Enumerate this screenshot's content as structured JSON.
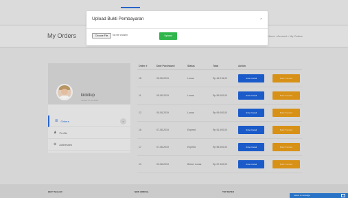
{
  "header": {
    "page_title": "My Orders",
    "breadcrumb": [
      "Home",
      "Account",
      "My Orders"
    ],
    "breadcrumb_separator": "›"
  },
  "profile": {
    "username": "kickitup",
    "joined": "Joined 17 Jul 2019",
    "nav": [
      {
        "label": "Orders",
        "icon": "orders-icon",
        "glyph": "☰",
        "count": "6",
        "active": true
      },
      {
        "label": "Profile",
        "icon": "user-icon",
        "glyph": "♟",
        "active": false
      },
      {
        "label": "Addresses",
        "icon": "location-icon",
        "glyph": "⊕",
        "active": false
      }
    ]
  },
  "orders": {
    "columns": [
      "Order #",
      "Date Purchased",
      "Status",
      "Total",
      "Action",
      ""
    ],
    "rows": [
      {
        "id": "18",
        "date": "05-08-2019",
        "status": "Lunas",
        "total": "Rp 46.216,00",
        "detail": "Order Detail",
        "upload": "Bukti Transfer"
      },
      {
        "id": "11",
        "date": "05-08-2019",
        "status": "Lunas",
        "total": "Rp 59.000,00",
        "detail": "Order Detail",
        "upload": "Bukti Transfer"
      },
      {
        "id": "12",
        "date": "05-08-2019",
        "status": "Lunas",
        "total": "Rp 99.000,00",
        "detail": "Order Detail",
        "upload": "Bukti Transfer"
      },
      {
        "id": "16",
        "date": "07-08-2019",
        "status": "Expired",
        "total": "Rp 51.000,00",
        "detail": "Order Detail",
        "upload": "Bukti Transfer"
      },
      {
        "id": "17",
        "date": "07-08-2019",
        "status": "Expired",
        "total": "Rp 55.000,00",
        "detail": "Order Detail",
        "upload": "Bukti Transfer"
      },
      {
        "id": "19",
        "date": "09-08-2019",
        "status": "Belum Lunas",
        "total": "Rp 67.400,00",
        "detail": "Order Detail",
        "upload": "Bukti Transfer"
      }
    ]
  },
  "footer": {
    "col1": "BEST SELLER",
    "col2": "NEW ARRIVAL",
    "col3": "TOP RATED",
    "chat_label": "Leave a message"
  },
  "modal": {
    "title": "Upload Bukti Pembayaran",
    "close": "×",
    "choose_file_label": "Choose File",
    "file_status": "No file chosen",
    "upload_label": "Upload"
  },
  "colors": {
    "primary": "#1d61d6",
    "warning": "#e69b19",
    "success": "#2fb64b",
    "danger": "#d9534f"
  }
}
